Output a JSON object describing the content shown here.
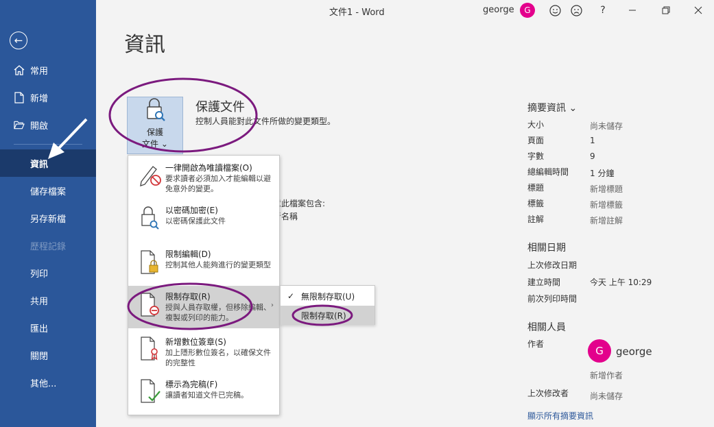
{
  "window": {
    "title": "文件1  -  Word",
    "user": "george",
    "user_initial": "G"
  },
  "sidebar": {
    "back": "back-arrow",
    "items": [
      {
        "label": "常用",
        "icon": "home-icon"
      },
      {
        "label": "新增",
        "icon": "new-document-icon"
      },
      {
        "label": "開啟",
        "icon": "folder-open-icon"
      },
      {
        "label": "資訊",
        "active": true
      },
      {
        "label": "儲存檔案"
      },
      {
        "label": "另存新檔"
      },
      {
        "label": "歷程記錄",
        "disabled": true
      },
      {
        "label": "列印"
      },
      {
        "label": "共用"
      },
      {
        "label": "匯出"
      },
      {
        "label": "關閉"
      },
      {
        "label": "其他..."
      }
    ]
  },
  "page": {
    "title": "資訊"
  },
  "protect": {
    "button_line1": "保護",
    "button_line2": "文件",
    "chevron": "⌄",
    "heading": "保護文件",
    "description": "控制人員能對此文件所做的變更類型。",
    "partial_text_1": "意此檔案包含:",
    "partial_text_2": "者名稱"
  },
  "menu": {
    "items": [
      {
        "title": "一律開啟為唯讀檔案(O)",
        "desc": "要求讀者必須加入才能編輯以避免意外的變更。",
        "icon": "pencil-no-icon"
      },
      {
        "title": "以密碼加密(E)",
        "desc": "以密碼保護此文件",
        "icon": "lock-key-icon"
      },
      {
        "title": "限制編輯(D)",
        "desc": "控制其他人能夠進行的變更類型",
        "icon": "doc-lock-icon"
      },
      {
        "title": "限制存取(R)",
        "desc": "授與人員存取權，但移除編輯、複製或列印的能力。",
        "icon": "doc-restrict-icon",
        "highlighted": true
      },
      {
        "title": "新增數位簽章(S)",
        "desc": "加上隱形數位簽名，以確保文件的完整性",
        "icon": "doc-ribbon-icon"
      },
      {
        "title": "標示為完稿(F)",
        "desc": "讓讀者知道文件已完稿。",
        "icon": "doc-check-icon"
      }
    ],
    "submenu_arrow": "›"
  },
  "submenu": {
    "items": [
      {
        "label": "無限制存取(U)",
        "checked": true
      },
      {
        "label": "限制存取(R)",
        "checked": false,
        "highlighted": true
      }
    ],
    "check": "✓"
  },
  "properties": {
    "heading": "摘要資訊",
    "chevron": "⌄",
    "rows": [
      {
        "label": "大小",
        "value": "尚未儲存",
        "muted": true
      },
      {
        "label": "頁面",
        "value": "1"
      },
      {
        "label": "字數",
        "value": "9"
      },
      {
        "label": "總編輯時間",
        "value": "1 分鐘"
      },
      {
        "label": "標題",
        "value": "新增標題",
        "muted": true
      },
      {
        "label": "標籤",
        "value": "新增標籤",
        "muted": true
      },
      {
        "label": "註解",
        "value": "新增註解",
        "muted": true
      }
    ],
    "dates_heading": "相關日期",
    "dates": [
      {
        "label": "上次修改日期",
        "value": ""
      },
      {
        "label": "建立時間",
        "value": "今天 上午 10:29"
      },
      {
        "label": "前次列印時間",
        "value": ""
      }
    ],
    "people_heading": "相關人員",
    "author_label": "作者",
    "author_name": "george",
    "author_initial": "G",
    "add_author": "新增作者",
    "last_modified_by_label": "上次修改者",
    "last_modified_by_value": "尚未儲存",
    "show_all": "顯示所有摘要資訊"
  },
  "colors": {
    "sidebar": "#2b579a",
    "accent_active": "#1b3a6b",
    "avatar": "#e3008c",
    "annotation": "#7b1a7e"
  }
}
